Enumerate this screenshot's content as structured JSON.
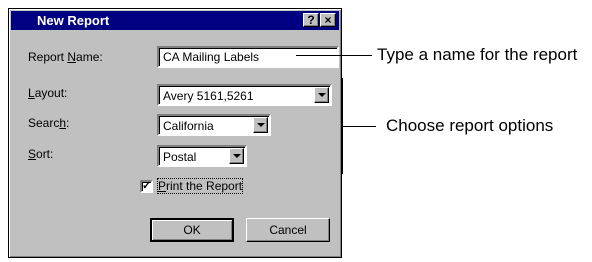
{
  "dialog": {
    "title": "New Report",
    "help_button": "?",
    "close_button": "×"
  },
  "form": {
    "report_name": {
      "label_prefix": "Report ",
      "label_hotkey": "N",
      "label_suffix": "ame:",
      "value": "CA Mailing Labels"
    },
    "layout": {
      "label_hotkey": "L",
      "label_suffix": "ayout:",
      "value": "Avery 5161,5261"
    },
    "search": {
      "label_prefix": "Searc",
      "label_hotkey": "h",
      "label_suffix": ":",
      "value": "California"
    },
    "sort": {
      "label_hotkey": "S",
      "label_suffix": "ort:",
      "value": "Postal"
    },
    "print_checkbox": {
      "label_hotkey": "P",
      "label_suffix": "rint the Report",
      "checked_mark": "✓"
    }
  },
  "buttons": {
    "ok": "OK",
    "cancel": "Cancel"
  },
  "callouts": {
    "name": "Type a name for the report",
    "options": "Choose report options"
  }
}
